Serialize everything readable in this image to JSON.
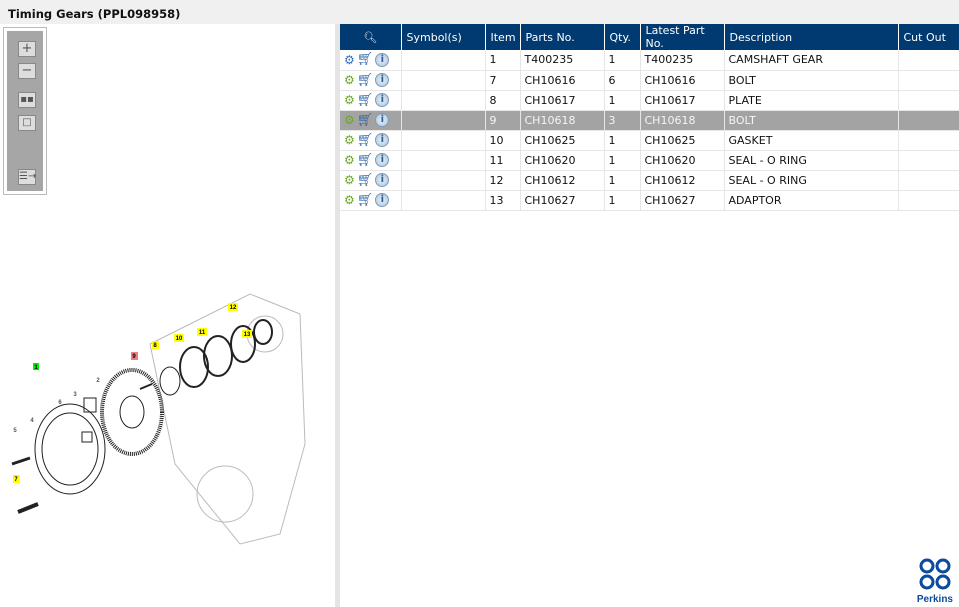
{
  "title": "Timing Gears (PPL098958)",
  "toolbar": [
    "zoom-in",
    "zoom-out",
    "fit-all",
    "actual-size",
    "toggle-list"
  ],
  "table": {
    "columns": [
      "",
      "Symbol(s)",
      "Item",
      "Parts No.",
      "Qty.",
      "Latest Part No.",
      "Description",
      "Cut Out"
    ],
    "rows": [
      {
        "item": "1",
        "part": "T400235",
        "qty": "1",
        "latest": "T400235",
        "desc": "CAMSHAFT GEAR",
        "assembly": true
      },
      {
        "item": "7",
        "part": "CH10616",
        "qty": "6",
        "latest": "CH10616",
        "desc": "BOLT"
      },
      {
        "item": "8",
        "part": "CH10617",
        "qty": "1",
        "latest": "CH10617",
        "desc": "PLATE"
      },
      {
        "item": "9",
        "part": "CH10618",
        "qty": "3",
        "latest": "CH10618",
        "desc": "BOLT",
        "selected": true
      },
      {
        "item": "10",
        "part": "CH10625",
        "qty": "1",
        "latest": "CH10625",
        "desc": "GASKET"
      },
      {
        "item": "11",
        "part": "CH10620",
        "qty": "1",
        "latest": "CH10620",
        "desc": "SEAL - O RING"
      },
      {
        "item": "12",
        "part": "CH10612",
        "qty": "1",
        "latest": "CH10612",
        "desc": "SEAL - O RING"
      },
      {
        "item": "13",
        "part": "CH10627",
        "qty": "1",
        "latest": "CH10627",
        "desc": "ADAPTOR"
      }
    ]
  },
  "diagram": {
    "callouts": [
      "1",
      "2",
      "3",
      "4",
      "5",
      "6",
      "7",
      "8",
      "9",
      "10",
      "11",
      "12",
      "13"
    ]
  },
  "logo": "Perkins",
  "colors": {
    "header": "#003a70",
    "selected": "#a3a3a3",
    "callout_yellow": "#ffff00",
    "callout_red": "#f08080",
    "callout_green": "#00ee00"
  }
}
